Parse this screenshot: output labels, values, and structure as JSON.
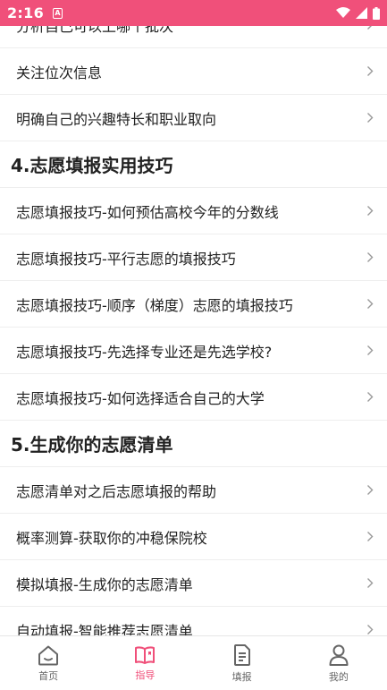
{
  "status_bar": {
    "time": "2:16",
    "notif_letter": "A",
    "background": "#f0507a"
  },
  "partial_item": {
    "label": "分析自己可以上哪个批次"
  },
  "list_items_top": [
    {
      "label": "关注位次信息"
    },
    {
      "label": "明确自己的兴趣特长和职业取向"
    }
  ],
  "section4": {
    "title": "4.志愿填报实用技巧",
    "items": [
      {
        "label": "志愿填报技巧-如何预估高校今年的分数线"
      },
      {
        "label": "志愿填报技巧-平行志愿的填报技巧"
      },
      {
        "label": "志愿填报技巧-顺序（梯度）志愿的填报技巧"
      },
      {
        "label": "志愿填报技巧-先选择专业还是先选学校?"
      },
      {
        "label": "志愿填报技巧-如何选择适合自己的大学"
      }
    ]
  },
  "section5": {
    "title": "5.生成你的志愿清单",
    "items": [
      {
        "label": "志愿清单对之后志愿填报的帮助"
      },
      {
        "label": "概率测算-获取你的冲稳保院校"
      },
      {
        "label": "模拟填报-生成你的志愿清单"
      },
      {
        "label": "自动填报-智能推荐志愿清单"
      }
    ]
  },
  "tabs": [
    {
      "label": "首页",
      "icon": "home-icon",
      "active": false
    },
    {
      "label": "指导",
      "icon": "book-icon",
      "active": true
    },
    {
      "label": "填报",
      "icon": "document-icon",
      "active": false
    },
    {
      "label": "我的",
      "icon": "person-icon",
      "active": false
    }
  ],
  "colors": {
    "accent": "#f0507a",
    "tab_inactive": "#666666",
    "chevron": "#999999"
  }
}
